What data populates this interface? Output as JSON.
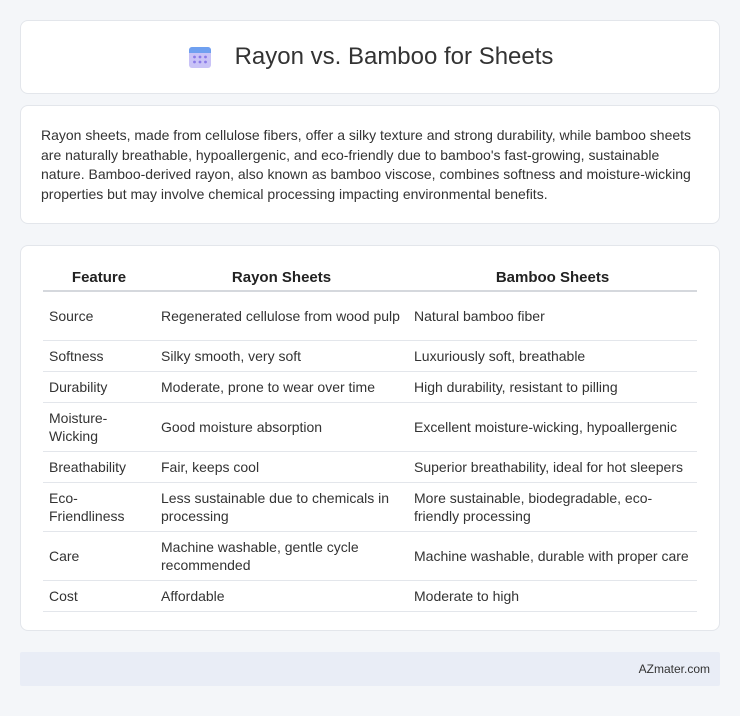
{
  "header": {
    "title": "Rayon vs. Bamboo for Sheets",
    "icon": "calendar-icon"
  },
  "intro": {
    "text": "Rayon sheets, made from cellulose fibers, offer a silky texture and strong durability, while bamboo sheets are naturally breathable, hypoallergenic, and eco-friendly due to bamboo's fast-growing, sustainable nature. Bamboo-derived rayon, also known as bamboo viscose, combines softness and moisture-wicking properties but may involve chemical processing impacting environmental benefits."
  },
  "table": {
    "headers": [
      "Feature",
      "Rayon Sheets",
      "Bamboo Sheets"
    ],
    "rows": [
      [
        "Source",
        "Regenerated cellulose from wood pulp",
        "Natural bamboo fiber"
      ],
      [
        "Softness",
        "Silky smooth, very soft",
        "Luxuriously soft, breathable"
      ],
      [
        "Durability",
        "Moderate, prone to wear over time",
        "High durability, resistant to pilling"
      ],
      [
        "Moisture-Wicking",
        "Good moisture absorption",
        "Excellent moisture-wicking, hypoallergenic"
      ],
      [
        "Breathability",
        "Fair, keeps cool",
        "Superior breathability, ideal for hot sleepers"
      ],
      [
        "Eco-Friendliness",
        "Less sustainable due to chemicals in processing",
        "More sustainable, biodegradable, eco-friendly processing"
      ],
      [
        "Care",
        "Machine washable, gentle cycle recommended",
        "Machine washable, durable with proper care"
      ],
      [
        "Cost",
        "Affordable",
        "Moderate to high"
      ]
    ]
  },
  "footer": {
    "text": "AZmater.com"
  },
  "colors": {
    "accent": "#7b6cf6",
    "background": "#f4f6f9",
    "footer_bg": "#e9edf6"
  }
}
